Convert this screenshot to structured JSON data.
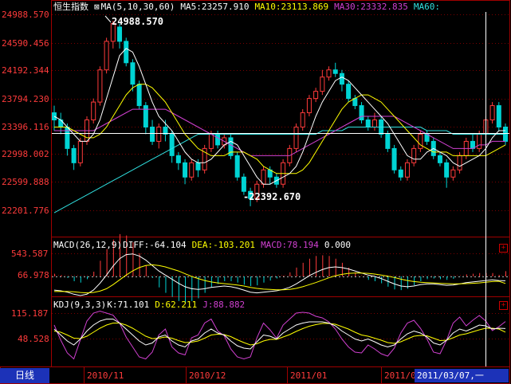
{
  "title": "恒生指数",
  "ma_header": {
    "label": "MA(5,10,30,60)",
    "ma5": "MA5:23257.910",
    "ma10": "MA10:23113.869",
    "ma30": "MA30:23332.835",
    "ma60": "MA60:"
  },
  "macd_header": {
    "label": "MACD(26,12,9)",
    "diff": "DIFF:-64.104",
    "dea": "DEA:-103.201",
    "macd": "MACD:78.194",
    "zero": "0.000"
  },
  "kdj_header": {
    "label": "KDJ(9,3,3)",
    "k": "K:71.101",
    "d": "D:62.211",
    "j": "J:88.882"
  },
  "main_axis": [
    "24988.570",
    "24590.456",
    "24192.344",
    "23794.230",
    "23396.116",
    "22998.002",
    "22599.888",
    "22201.776"
  ],
  "macd_axis": [
    "543.587",
    "66.978"
  ],
  "kdj_axis": [
    "115.187",
    "48.528"
  ],
  "annotations": {
    "high": "24988.570",
    "low": "-22392.670"
  },
  "x_labels": [
    "2010/11",
    "2010/12",
    "2011/01",
    "2011/02",
    "2011/03"
  ],
  "period_label": "日线",
  "cursor_date": "2011/03/07,一",
  "colors": {
    "up": "#ff3b3b",
    "down": "#00d4d4",
    "ma5": "#ffffff",
    "ma10": "#ffff00",
    "ma30": "#d040d0",
    "ma60": "#30e0e0",
    "grid": "#7a0000"
  },
  "chart_data": {
    "type": "candlestick",
    "ylim": [
      22000,
      25100
    ],
    "values": [
      [
        23700,
        23600,
        23800,
        23450
      ],
      [
        23600,
        23500,
        23700,
        23400
      ],
      [
        23500,
        23200,
        23550,
        23100
      ],
      [
        23200,
        23000,
        23250,
        22900
      ],
      [
        23000,
        23300,
        23350,
        22950
      ],
      [
        23300,
        23600,
        23650,
        23250
      ],
      [
        23600,
        23850,
        23900,
        23550
      ],
      [
        23850,
        24300,
        24350,
        23800
      ],
      [
        24300,
        24700,
        24750,
        24250
      ],
      [
        24700,
        24950,
        24988,
        24600
      ],
      [
        24900,
        24700,
        24950,
        24600
      ],
      [
        24700,
        24400,
        24750,
        24350
      ],
      [
        24400,
        24100,
        24450,
        24000
      ],
      [
        24100,
        23800,
        24150,
        23750
      ],
      [
        23800,
        23500,
        23850,
        23400
      ],
      [
        23500,
        23300,
        23600,
        23250
      ],
      [
        23300,
        23500,
        23550,
        23200
      ],
      [
        23500,
        23400,
        23600,
        23300
      ],
      [
        23400,
        23100,
        23450,
        23000
      ],
      [
        23100,
        23000,
        23150,
        22900
      ],
      [
        23000,
        22800,
        23050,
        22700
      ],
      [
        22800,
        23000,
        23050,
        22750
      ],
      [
        23000,
        22900,
        23050,
        22800
      ],
      [
        22900,
        23200,
        23250,
        22850
      ],
      [
        23200,
        23400,
        23450,
        23150
      ],
      [
        23400,
        23250,
        23450,
        23200
      ],
      [
        23250,
        23350,
        23400,
        23200
      ],
      [
        23350,
        23100,
        23400,
        23050
      ],
      [
        23100,
        22800,
        23150,
        22750
      ],
      [
        22800,
        22600,
        22850,
        22550
      ],
      [
        22600,
        22500,
        22650,
        22392
      ],
      [
        22500,
        22700,
        22750,
        22450
      ],
      [
        22700,
        22900,
        22950,
        22650
      ],
      [
        22900,
        22800,
        22950,
        22700
      ],
      [
        22800,
        22700,
        22850,
        22650
      ],
      [
        22700,
        23000,
        23050,
        22650
      ],
      [
        23000,
        23200,
        23250,
        22950
      ],
      [
        23200,
        23500,
        23550,
        23150
      ],
      [
        23500,
        23700,
        23750,
        23450
      ],
      [
        23700,
        23900,
        23950,
        23650
      ],
      [
        23900,
        24000,
        24050,
        23850
      ],
      [
        24000,
        24200,
        24300,
        23950
      ],
      [
        24200,
        24300,
        24350,
        24150
      ],
      [
        24300,
        24250,
        24400,
        24200
      ],
      [
        24250,
        24100,
        24300,
        24000
      ],
      [
        24100,
        23900,
        24150,
        23850
      ],
      [
        23900,
        23800,
        23950,
        23750
      ],
      [
        23800,
        23600,
        23850,
        23550
      ],
      [
        23600,
        23500,
        23650,
        23450
      ],
      [
        23500,
        23600,
        23700,
        23450
      ],
      [
        23600,
        23400,
        23650,
        23350
      ],
      [
        23400,
        23200,
        23450,
        23150
      ],
      [
        23200,
        22900,
        23250,
        22850
      ],
      [
        22900,
        22800,
        22950,
        22750
      ],
      [
        22800,
        23000,
        23050,
        22750
      ],
      [
        23000,
        23200,
        23250,
        22950
      ],
      [
        23200,
        23400,
        23450,
        23150
      ],
      [
        23400,
        23300,
        23450,
        23250
      ],
      [
        23300,
        23100,
        23350,
        23050
      ],
      [
        23100,
        23000,
        23150,
        22950
      ],
      [
        23000,
        22800,
        23050,
        22650
      ],
      [
        22800,
        22900,
        22950,
        22750
      ],
      [
        22900,
        23100,
        23150,
        22850
      ],
      [
        23100,
        23300,
        23350,
        23050
      ],
      [
        23300,
        23200,
        23400,
        23150
      ],
      [
        23200,
        23400,
        23450,
        23150
      ],
      [
        23400,
        23600,
        23650,
        23350
      ],
      [
        23600,
        23800,
        23850,
        23550
      ],
      [
        23800,
        23500,
        23850,
        23450
      ],
      [
        23500,
        23300,
        23550,
        23250
      ]
    ],
    "ma5": [
      23650,
      23600,
      23500,
      23400,
      23300,
      23300,
      23400,
      23600,
      23900,
      24200,
      24500,
      24600,
      24550,
      24350,
      24100,
      23850,
      23650,
      23550,
      23450,
      23300,
      23150,
      23050,
      23000,
      23000,
      23050,
      23150,
      23250,
      23300,
      23250,
      23100,
      22950,
      22800,
      22700,
      22700,
      22750,
      22800,
      22850,
      22950,
      23150,
      23400,
      23650,
      23850,
      24000,
      24150,
      24200,
      24150,
      24050,
      23950,
      23850,
      23750,
      23650,
      23550,
      23400,
      23250,
      23100,
      23050,
      23050,
      23150,
      23200,
      23150,
      23100,
      23000,
      22950,
      23000,
      23050,
      23100,
      23200,
      23350,
      23450,
      23450
    ],
    "ma10": [
      23500,
      23500,
      23500,
      23450,
      23400,
      23350,
      23350,
      23400,
      23500,
      23650,
      23800,
      23950,
      24050,
      24100,
      24100,
      24050,
      23950,
      23850,
      23700,
      23550,
      23400,
      23300,
      23200,
      23150,
      23100,
      23100,
      23100,
      23150,
      23150,
      23150,
      23100,
      23050,
      22950,
      22900,
      22850,
      22850,
      22850,
      22850,
      22900,
      23000,
      23150,
      23300,
      23450,
      23600,
      23750,
      23850,
      23900,
      23950,
      23950,
      23900,
      23850,
      23750,
      23650,
      23550,
      23450,
      23350,
      23250,
      23200,
      23150,
      23150,
      23150,
      23100,
      23100,
      23100,
      23100,
      23100,
      23100,
      23150,
      23200,
      23250
    ],
    "ma30": [
      23450,
      23450,
      23450,
      23450,
      23450,
      23450,
      23450,
      23500,
      23550,
      23600,
      23650,
      23700,
      23750,
      23750,
      23750,
      23750,
      23750,
      23750,
      23700,
      23650,
      23600,
      23550,
      23500,
      23450,
      23400,
      23350,
      23300,
      23250,
      23200,
      23150,
      23100,
      23100,
      23100,
      23100,
      23100,
      23100,
      23100,
      23150,
      23200,
      23250,
      23300,
      23350,
      23400,
      23450,
      23500,
      23550,
      23600,
      23650,
      23650,
      23650,
      23650,
      23650,
      23650,
      23600,
      23550,
      23500,
      23450,
      23400,
      23350,
      23300,
      23250,
      23200,
      23200,
      23200,
      23200,
      23250,
      23250,
      23300,
      23300,
      23300
    ],
    "ma60": [
      22300,
      22350,
      22400,
      22450,
      22500,
      22550,
      22600,
      22650,
      22700,
      22750,
      22800,
      22850,
      22900,
      22950,
      23000,
      23050,
      23100,
      23150,
      23200,
      23250,
      23300,
      23350,
      23400,
      23400,
      23400,
      23400,
      23400,
      23400,
      23400,
      23400,
      23400,
      23400,
      23400,
      23400,
      23400,
      23400,
      23400,
      23400,
      23400,
      23400,
      23400,
      23450,
      23450,
      23450,
      23450,
      23500,
      23500,
      23500,
      23500,
      23500,
      23500,
      23500,
      23500,
      23500,
      23500,
      23500,
      23500,
      23450,
      23450,
      23450,
      23450,
      23400,
      23400,
      23400,
      23400,
      23400,
      23400,
      23400,
      23400,
      23400
    ],
    "macd": [
      [
        -200,
        -220
      ],
      [
        -210,
        -218
      ],
      [
        -230,
        -220
      ],
      [
        -260,
        -225
      ],
      [
        -280,
        -235
      ],
      [
        -260,
        -240
      ],
      [
        -200,
        -235
      ],
      [
        -100,
        -215
      ],
      [
        20,
        -180
      ],
      [
        150,
        -120
      ],
      [
        260,
        -50
      ],
      [
        320,
        20
      ],
      [
        330,
        80
      ],
      [
        300,
        130
      ],
      [
        240,
        160
      ],
      [
        160,
        170
      ],
      [
        80,
        160
      ],
      [
        20,
        140
      ],
      [
        -40,
        110
      ],
      [
        -100,
        80
      ],
      [
        -150,
        40
      ],
      [
        -180,
        0
      ],
      [
        -190,
        -30
      ],
      [
        -180,
        -60
      ],
      [
        -160,
        -80
      ],
      [
        -150,
        -95
      ],
      [
        -140,
        -105
      ],
      [
        -150,
        -115
      ],
      [
        -170,
        -125
      ],
      [
        -200,
        -140
      ],
      [
        -230,
        -160
      ],
      [
        -240,
        -175
      ],
      [
        -230,
        -185
      ],
      [
        -220,
        -190
      ],
      [
        -210,
        -195
      ],
      [
        -190,
        -195
      ],
      [
        -160,
        -190
      ],
      [
        -110,
        -175
      ],
      [
        -50,
        -150
      ],
      [
        10,
        -120
      ],
      [
        60,
        -90
      ],
      [
        100,
        -55
      ],
      [
        130,
        -20
      ],
      [
        140,
        10
      ],
      [
        130,
        30
      ],
      [
        110,
        45
      ],
      [
        80,
        50
      ],
      [
        50,
        50
      ],
      [
        20,
        45
      ],
      [
        0,
        35
      ],
      [
        -30,
        20
      ],
      [
        -70,
        5
      ],
      [
        -110,
        -15
      ],
      [
        -140,
        -40
      ],
      [
        -150,
        -60
      ],
      [
        -140,
        -75
      ],
      [
        -120,
        -85
      ],
      [
        -110,
        -90
      ],
      [
        -110,
        -95
      ],
      [
        -120,
        -100
      ],
      [
        -130,
        -105
      ],
      [
        -125,
        -108
      ],
      [
        -110,
        -108
      ],
      [
        -90,
        -105
      ],
      [
        -80,
        -100
      ],
      [
        -70,
        -95
      ],
      [
        -60,
        -85
      ],
      [
        -50,
        -75
      ],
      [
        -60,
        -70
      ],
      [
        -64,
        -103
      ]
    ],
    "kdj": [
      [
        70,
        65,
        80
      ],
      [
        55,
        62,
        42
      ],
      [
        40,
        55,
        10
      ],
      [
        30,
        47,
        -5
      ],
      [
        45,
        46,
        43
      ],
      [
        65,
        52,
        90
      ],
      [
        80,
        62,
        110
      ],
      [
        90,
        72,
        115
      ],
      [
        95,
        80,
        110
      ],
      [
        95,
        85,
        105
      ],
      [
        85,
        85,
        85
      ],
      [
        70,
        80,
        50
      ],
      [
        55,
        72,
        25
      ],
      [
        40,
        62,
        0
      ],
      [
        30,
        52,
        -5
      ],
      [
        35,
        46,
        12
      ],
      [
        50,
        47,
        55
      ],
      [
        55,
        50,
        70
      ],
      [
        40,
        47,
        25
      ],
      [
        30,
        41,
        10
      ],
      [
        25,
        36,
        5
      ],
      [
        40,
        37,
        48
      ],
      [
        45,
        40,
        55
      ],
      [
        60,
        47,
        85
      ],
      [
        70,
        55,
        95
      ],
      [
        60,
        57,
        65
      ],
      [
        55,
        56,
        53
      ],
      [
        40,
        51,
        20
      ],
      [
        28,
        43,
        0
      ],
      [
        22,
        36,
        -5
      ],
      [
        20,
        30,
        0
      ],
      [
        38,
        33,
        48
      ],
      [
        55,
        40,
        85
      ],
      [
        52,
        44,
        68
      ],
      [
        45,
        44,
        47
      ],
      [
        60,
        50,
        80
      ],
      [
        70,
        56,
        95
      ],
      [
        80,
        64,
        110
      ],
      [
        85,
        71,
        112
      ],
      [
        88,
        77,
        110
      ],
      [
        88,
        81,
        102
      ],
      [
        88,
        84,
        98
      ],
      [
        85,
        84,
        88
      ],
      [
        78,
        82,
        70
      ],
      [
        65,
        76,
        45
      ],
      [
        55,
        70,
        25
      ],
      [
        45,
        62,
        12
      ],
      [
        40,
        55,
        10
      ],
      [
        45,
        52,
        30
      ],
      [
        38,
        47,
        20
      ],
      [
        30,
        42,
        8
      ],
      [
        25,
        36,
        2
      ],
      [
        30,
        34,
        22
      ],
      [
        45,
        38,
        60
      ],
      [
        58,
        45,
        85
      ],
      [
        65,
        52,
        92
      ],
      [
        60,
        54,
        72
      ],
      [
        50,
        53,
        45
      ],
      [
        35,
        47,
        12
      ],
      [
        30,
        41,
        8
      ],
      [
        42,
        42,
        42
      ],
      [
        60,
        48,
        85
      ],
      [
        70,
        55,
        100
      ],
      [
        65,
        58,
        78
      ],
      [
        72,
        63,
        92
      ],
      [
        80,
        68,
        104
      ],
      [
        78,
        72,
        90
      ],
      [
        70,
        72,
        66
      ],
      [
        72,
        70,
        76
      ],
      [
        71.101,
        62.211,
        88.882
      ]
    ]
  }
}
